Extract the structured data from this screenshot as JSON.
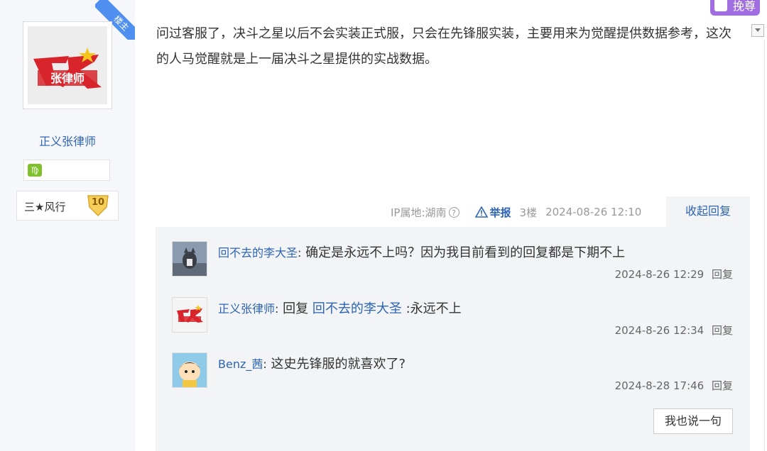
{
  "author": {
    "name": "正义张律师",
    "role_badge": "楼主",
    "level_title": "三★风行",
    "level_number": "10",
    "avatar_icon": "zhangls-logo-avatar",
    "medal_icon": "virgo-medal-icon"
  },
  "corner_tag": {
    "label": "挽尊",
    "icon": "hand-icon"
  },
  "post": {
    "text": "问过客服了，决斗之星以后不会实装正式服，只会在先锋服实装，主要用来为觉醒提供数据参考，这次的人马觉醒就是上一届决斗之星提供的实战数据。"
  },
  "meta": {
    "ip_location": "IP属地:湖南",
    "help_icon": "?",
    "report_label": "举报",
    "floor": "3楼",
    "date": "2024-08-26 12:10",
    "collapse_label": "收起回复"
  },
  "replies": [
    {
      "user": "回不去的李大圣",
      "colon": ":",
      "text": " 确定是永远不上吗？因为我目前看到的回复都是下期不上",
      "time": "2024-8-26 12:29",
      "reply_label": "回复",
      "avatar_icon": "cat-photo-avatar"
    },
    {
      "user": "正义张律师",
      "colon": ":",
      "prefix": " 回复 ",
      "target": "回不去的李大圣",
      "text": " :永远不上",
      "time": "2024-8-26 12:34",
      "reply_label": "回复",
      "avatar_icon": "zhangls-logo-avatar"
    },
    {
      "user": "Benz_茜",
      "colon": ":",
      "text": " 这史先锋服的就喜欢了?",
      "time": "2024-8-28 17:46",
      "reply_label": "回复",
      "avatar_icon": "cartoon-boy-avatar"
    }
  ],
  "say_button": "我也说一句",
  "colors": {
    "link": "#2d64b3",
    "panel": "#f3f4f6",
    "tag": "#a06ee1",
    "badge": "#4e8ff0"
  }
}
